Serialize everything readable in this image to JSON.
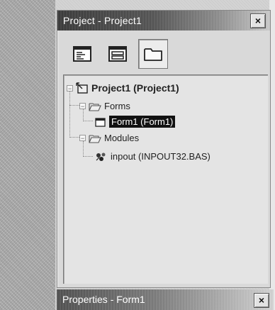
{
  "project_window": {
    "title": "Project - Project1",
    "close_label": "×",
    "toolbar": [
      {
        "icon": "view-code-icon",
        "tooltip": ""
      },
      {
        "icon": "view-object-icon",
        "tooltip": ""
      },
      {
        "icon": "toggle-folders-icon",
        "tooltip": ""
      }
    ],
    "tree": {
      "project": "Project1 (Project1)",
      "forms_folder": "Forms",
      "form_item": "Form1 (Form1)",
      "modules_folder": "Modules",
      "module_item": "inpout (INPOUT32.BAS)",
      "expander_open": "−"
    }
  },
  "properties_window": {
    "title": "Properties - Form1",
    "close_label": "×"
  }
}
